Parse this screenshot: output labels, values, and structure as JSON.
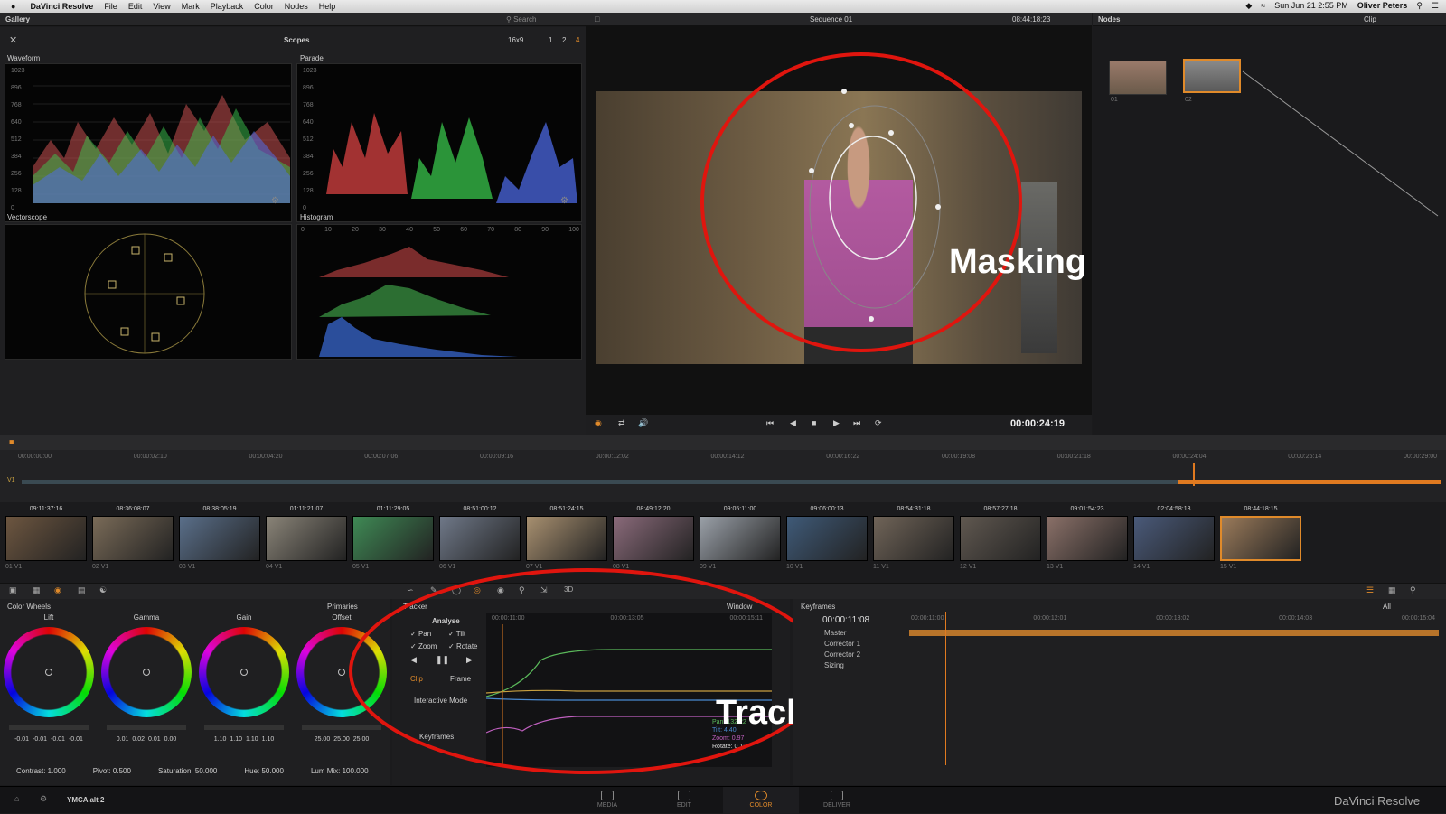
{
  "menubar": {
    "app": "DaVinci Resolve",
    "items": [
      "File",
      "Edit",
      "View",
      "Mark",
      "Playback",
      "Color",
      "Nodes",
      "Help"
    ],
    "clock": "Sun Jun 21  2:55 PM",
    "user": "Oliver Peters"
  },
  "gallery": {
    "title": "Gallery",
    "search": "Search"
  },
  "scopes": {
    "title": "Scopes",
    "aspect": "16x9",
    "views": [
      "1",
      "2",
      "4"
    ],
    "waveform": "Waveform",
    "parade": "Parade",
    "vectorscope": "Vectorscope",
    "histogram": "Histogram",
    "levels": [
      "1023",
      "896",
      "768",
      "640",
      "512",
      "384",
      "256",
      "128",
      "0"
    ],
    "hist_ticks": [
      "0",
      "10",
      "20",
      "30",
      "40",
      "50",
      "60",
      "70",
      "80",
      "90",
      "100"
    ]
  },
  "viewer": {
    "sequence": "Sequence 01",
    "timecode": "08:44:18:23",
    "playhead": "00:00:24:19"
  },
  "nodes": {
    "title": "Nodes",
    "mode": "Clip",
    "n1": "01",
    "n2": "02"
  },
  "annotations": {
    "masking": "Masking",
    "tracking": "Tracking"
  },
  "timeline": {
    "ticks": [
      "00:00:00:00",
      "00:00:02:10",
      "00:00:04:20",
      "00:00:07:06",
      "00:00:09:16",
      "00:00:12:02",
      "00:00:14:12",
      "00:00:16:22",
      "00:00:19:08",
      "00:00:21:18",
      "00:00:24:04",
      "00:00:26:14",
      "00:00:29:00"
    ],
    "track": "V1"
  },
  "clips": [
    {
      "tc": "09:11:37:16",
      "label": "01  V1",
      "color": "#6d5640"
    },
    {
      "tc": "08:36:08:07",
      "label": "02  V1",
      "color": "#7a6b58"
    },
    {
      "tc": "08:38:05:19",
      "label": "03  V1",
      "color": "#5a6f8a"
    },
    {
      "tc": "01:11:21:07",
      "label": "04  V1",
      "color": "#8a8478"
    },
    {
      "tc": "01:11:29:05",
      "label": "05  V1",
      "color": "#3f8a55"
    },
    {
      "tc": "08:51:00:12",
      "label": "06  V1",
      "color": "#6f7888"
    },
    {
      "tc": "08:51:24:15",
      "label": "07  V1",
      "color": "#a89070"
    },
    {
      "tc": "08:49:12:20",
      "label": "08  V1",
      "color": "#8a6a7a"
    },
    {
      "tc": "09:05:11:00",
      "label": "09  V1",
      "color": "#9aa0a8"
    },
    {
      "tc": "09:06:00:13",
      "label": "10  V1",
      "color": "#3f5a78"
    },
    {
      "tc": "08:54:31:18",
      "label": "11  V1",
      "color": "#706458"
    },
    {
      "tc": "08:57:27:18",
      "label": "12  V1",
      "color": "#605850"
    },
    {
      "tc": "09:01:54:23",
      "label": "13  V1",
      "color": "#8a7068"
    },
    {
      "tc": "02:04:58:13",
      "label": "14  V1",
      "color": "#4a5a7a"
    },
    {
      "tc": "08:44:18:15",
      "label": "15  V1",
      "color": "#9a7a5a"
    }
  ],
  "colorwheels": {
    "title": "Color Wheels",
    "mode": "Primaries",
    "wheels": [
      {
        "name": "Lift",
        "values": [
          "-0.01",
          "-0.01",
          "-0.01",
          "-0.01"
        ]
      },
      {
        "name": "Gamma",
        "values": [
          "0.01",
          "0.02",
          "0.01",
          "0.00"
        ]
      },
      {
        "name": "Gain",
        "values": [
          "1.10",
          "1.10",
          "1.10",
          "1.10"
        ]
      },
      {
        "name": "Offset",
        "values": [
          "25.00",
          "25.00",
          "25.00"
        ]
      }
    ],
    "contrast": "Contrast: 1.000",
    "pivot": "Pivot: 0.500",
    "saturation": "Saturation: 50.000",
    "hue": "Hue: 50.000",
    "lummix": "Lum Mix: 100.000"
  },
  "tracker": {
    "title": "Tracker",
    "analyse": "Analyse",
    "pan": "Pan",
    "tilt": "Tilt",
    "zoom": "Zoom",
    "rotate": "Rotate",
    "clip": "Clip",
    "frame": "Frame",
    "interactive": "Interactive Mode",
    "keyframes": "Keyframes",
    "window": "Window",
    "t1": "00:00:11:00",
    "t2": "00:00:13:05",
    "t3": "00:00:15:11",
    "pan_v": "Pan: 132.22",
    "tilt_v": "Tilt: 4.40",
    "zoom_v": "Zoom: 0.97",
    "rotate_v": "Rotate: 0.13"
  },
  "keyframes": {
    "title": "Keyframes",
    "filter": "All",
    "current": "00:00:11:08",
    "tracks": [
      "Master",
      "Corrector 1",
      "Corrector 2",
      "Sizing"
    ],
    "ticks": [
      "00:00:11:00",
      "00:00:12:01",
      "00:00:13:02",
      "00:00:14:03",
      "00:00:15:04"
    ]
  },
  "footer": {
    "project": "YMCA alt 2",
    "tabs": [
      "MEDIA",
      "EDIT",
      "COLOR",
      "DELIVER"
    ],
    "brand": "DaVinci Resolve"
  }
}
